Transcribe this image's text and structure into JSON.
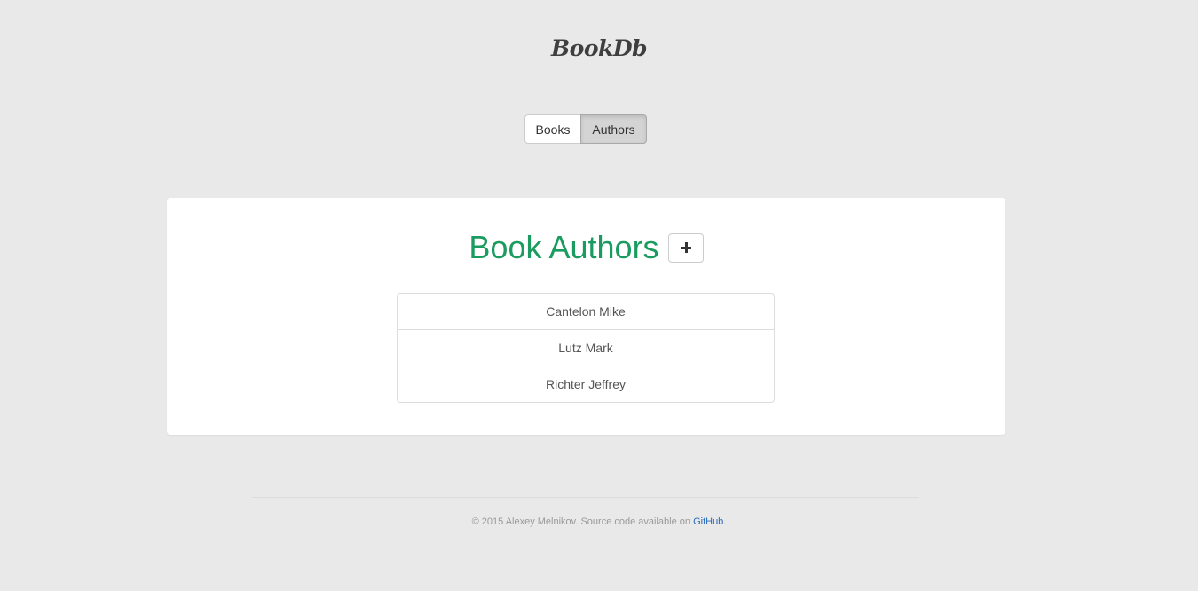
{
  "brand": "BookDb",
  "nav": {
    "books_label": "Books",
    "authors_label": "Authors",
    "active": "Authors"
  },
  "main": {
    "heading": "Book Authors",
    "add_button_icon": "plus-icon",
    "authors": [
      "Cantelon Mike",
      "Lutz Mark",
      "Richter Jeffrey"
    ]
  },
  "footer": {
    "text_before": "© 2015 Alexey Melnikov. Source code available on ",
    "link_label": "GitHub",
    "text_after": "."
  },
  "colors": {
    "background": "#e9e9e9",
    "heading_accent": "#1a9b5f",
    "link": "#2a6ab8"
  }
}
